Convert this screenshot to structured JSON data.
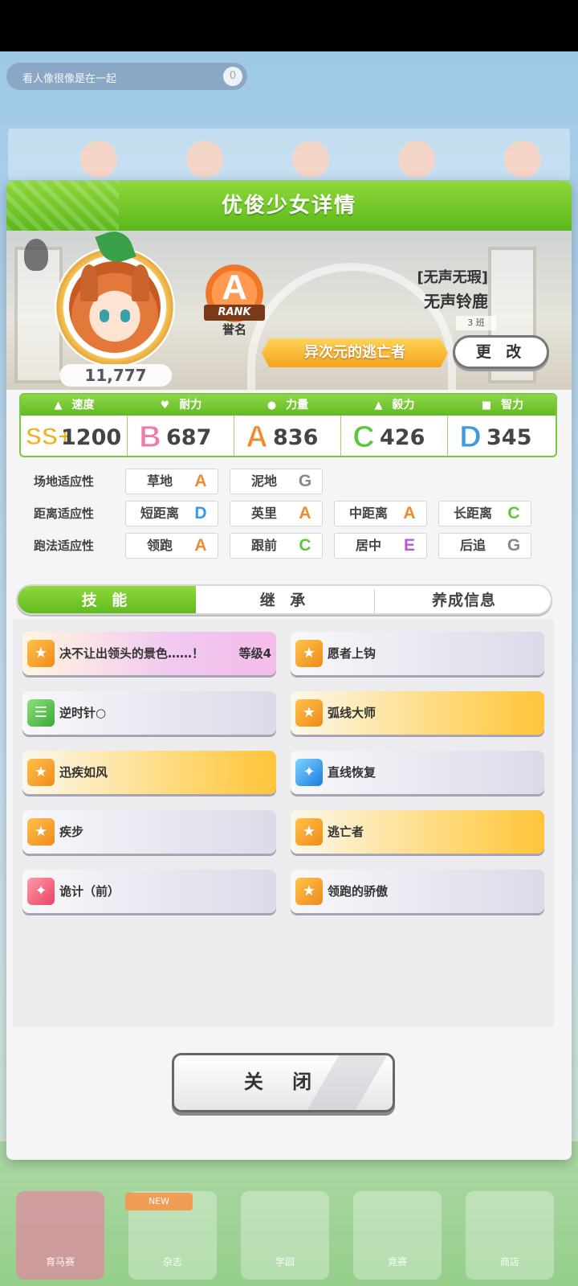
{
  "background": {
    "title_ghost": "看人像很像是在一起",
    "title_ghost_btn": "0",
    "nav_new_badge": "NEW",
    "nav": [
      "育马赛",
      "杂志",
      "学园",
      "竞赛",
      "商店"
    ]
  },
  "dialog": {
    "title": "优俊少女详情",
    "profile": {
      "fans": "11,777",
      "rank_letter": "A",
      "rank_word": "RANK",
      "rank_label": "誉名",
      "epithet": "[无声无瑕]",
      "name": "无声铃鹿",
      "class_tag": "3 班",
      "title_ribbon": "异次元的逃亡者",
      "change_button": "更 改"
    },
    "stats": [
      {
        "name": "速度",
        "icon": "shoe-icon",
        "grade": "SS+",
        "value": "1200",
        "color": "#f0b21a"
      },
      {
        "name": "耐力",
        "icon": "heart-icon",
        "grade": "B",
        "value": "687",
        "color": "#f07aa8"
      },
      {
        "name": "力量",
        "icon": "muscle-icon",
        "grade": "A",
        "value": "836",
        "color": "#f08a2a"
      },
      {
        "name": "毅力",
        "icon": "flame-icon",
        "grade": "C",
        "value": "426",
        "color": "#5ac83a"
      },
      {
        "name": "智力",
        "icon": "grad-cap-icon",
        "grade": "D",
        "value": "345",
        "color": "#3a9ae8"
      }
    ],
    "aptitude": {
      "surface": {
        "label": "场地适应性",
        "items": [
          {
            "name": "草地",
            "grade": "A"
          },
          {
            "name": "泥地",
            "grade": "G"
          }
        ]
      },
      "distance": {
        "label": "距离适应性",
        "items": [
          {
            "name": "短距离",
            "grade": "D"
          },
          {
            "name": "英里",
            "grade": "A"
          },
          {
            "name": "中距离",
            "grade": "A"
          },
          {
            "name": "长距离",
            "grade": "C"
          }
        ]
      },
      "style": {
        "label": "跑法适应性",
        "items": [
          {
            "name": "领跑",
            "grade": "A"
          },
          {
            "name": "跟前",
            "grade": "C"
          },
          {
            "name": "居中",
            "grade": "E"
          },
          {
            "name": "后追",
            "grade": "G"
          }
        ]
      }
    },
    "tabs": [
      "技 能",
      "继 承",
      "养成信息"
    ],
    "skills": [
      {
        "name": "决不让出领头的景色……！",
        "level": "等级4",
        "type": "unique",
        "icon": "orange"
      },
      {
        "name": "愿者上钩",
        "level": "",
        "type": "normal",
        "icon": "orange"
      },
      {
        "name": "逆时针○",
        "level": "",
        "type": "normal",
        "icon": "green"
      },
      {
        "name": "弧线大师",
        "level": "",
        "type": "gold",
        "icon": "orange"
      },
      {
        "name": "迅疾如风",
        "level": "",
        "type": "gold",
        "icon": "orange"
      },
      {
        "name": "直线恢复",
        "level": "",
        "type": "normal",
        "icon": "blue"
      },
      {
        "name": "疾步",
        "level": "",
        "type": "normal",
        "icon": "orange"
      },
      {
        "name": "逃亡者",
        "level": "",
        "type": "gold",
        "icon": "orange"
      },
      {
        "name": "诡计（前）",
        "level": "",
        "type": "normal",
        "icon": "red"
      },
      {
        "name": "领跑的骄傲",
        "level": "",
        "type": "normal",
        "icon": "orange"
      }
    ],
    "close_button": "关 闭"
  }
}
